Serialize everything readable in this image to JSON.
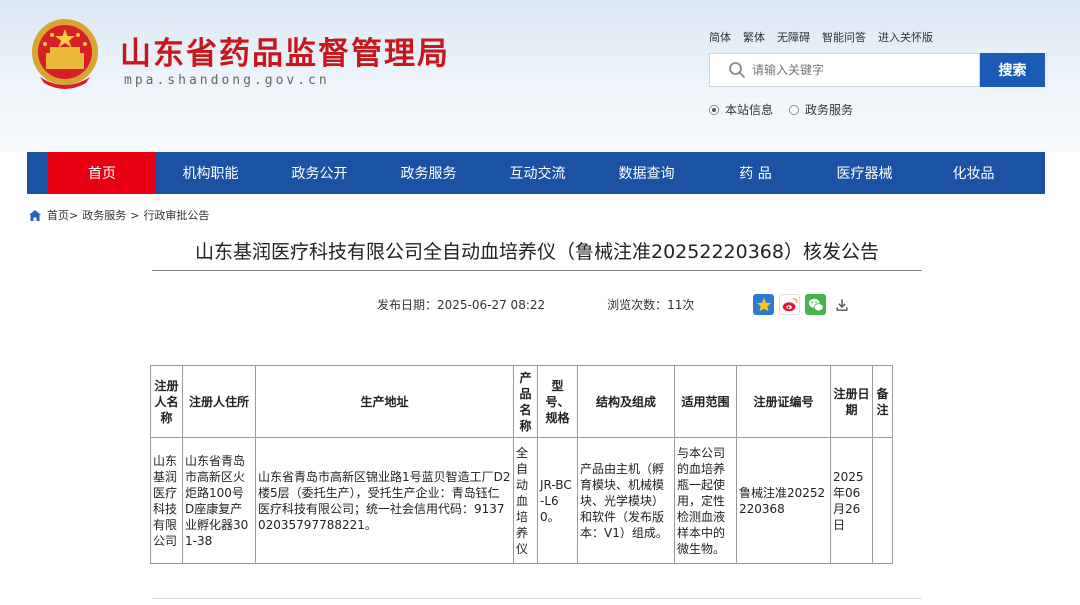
{
  "header": {
    "site_title": "山东省药品监督管理局",
    "site_domain": "mpa.shandong.gov.cn",
    "top_links": [
      "简体",
      "繁体",
      "无障碍",
      "智能问答",
      "进入关怀版"
    ],
    "search": {
      "placeholder": "请输入关键字",
      "button_label": "搜索"
    },
    "scope_options": [
      {
        "label": "本站信息",
        "selected": true
      },
      {
        "label": "政务服务",
        "selected": false
      }
    ]
  },
  "nav": {
    "items": [
      "首页",
      "机构职能",
      "政务公开",
      "政务服务",
      "互动交流",
      "数据查询",
      "药 品",
      "医疗器械",
      "化妆品"
    ],
    "active_index": 0,
    "active_color": "#e60012",
    "bar_color": "#1b52a4"
  },
  "breadcrumb": [
    "首页>",
    "政务服务",
    ">",
    "行政审批公告"
  ],
  "article": {
    "title": "山东基润医疗科技有限公司全自动血培养仪（鲁械注准20252220368）核发公告",
    "publish_date": "发布日期：2025-06-27 08:22",
    "views": "浏览次数：11次"
  },
  "table": {
    "headers": [
      "注册人名称",
      "注册人住所",
      "生产地址",
      "产品名称",
      "型号、规格",
      "结构及组成",
      "适用范围",
      "注册证编号",
      "注册日期",
      "备注"
    ],
    "row": [
      "山东基润医疗科技有限公司",
      "山东省青岛市高新区火炬路100号D座康复产业孵化器301-38",
      "山东省青岛市高新区锦业路1号蓝贝智造工厂D2楼5层（委托生产），受托生产企业：青岛钰仁医疗科技有限公司；统一社会信用代码：91370203579778822​1。",
      "全自动血培养仪",
      "JR-BC-L60。",
      "产品由主机（孵育模块、机械模块、光学模块）和软件（发布版本：V1）组成。",
      "与本公司的血培养瓶一起使用，定性检测血液样本中的微生物。",
      "鲁械注准20252220368",
      "2025年06月26日",
      ""
    ]
  },
  "icons": {
    "emblem": "national-emblem-icon",
    "search": "search-icon",
    "home": "home-icon",
    "share": [
      "qzone-share-icon",
      "weibo-share-icon",
      "wechat-share-icon",
      "download-icon"
    ]
  }
}
